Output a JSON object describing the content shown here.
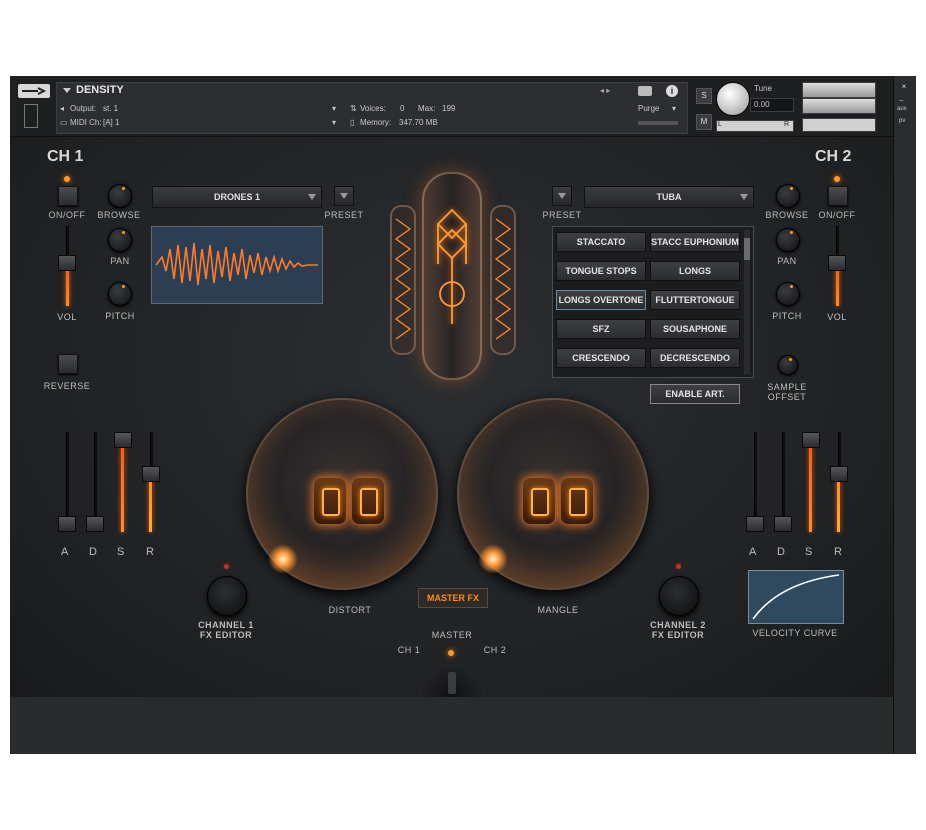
{
  "header": {
    "title": "DENSITY",
    "output_label": "Output:",
    "output_value": "st. 1",
    "midi_label": "MIDI Ch:",
    "midi_value": "[A]  1",
    "voices_label": "Voices:",
    "voices_value": "0",
    "max_label": "Max:",
    "max_value": "199",
    "memory_label": "Memory:",
    "memory_value": "347.70 MB",
    "purge_label": "Purge",
    "tune_label": "Tune",
    "tune_value": "0.00",
    "s_label": "S",
    "m_label": "M",
    "l_label": "L",
    "r_label": "R",
    "aux_label": "aux",
    "pv_label": "pv",
    "close_label": "×",
    "min_label": "−"
  },
  "ch1": {
    "title": "CH 1",
    "on_off": "ON/OFF",
    "browse": "BROWSE",
    "pan": "PAN",
    "pitch": "PITCH",
    "vol": "VOL",
    "reverse": "REVERSE",
    "preset_label": "PRESET",
    "preset_value": "DRONES 1",
    "adsr": [
      "A",
      "D",
      "S",
      "R"
    ],
    "adsr_levels": [
      0.0,
      0.0,
      1.0,
      0.6
    ],
    "vol_level": 0.55
  },
  "ch2": {
    "title": "CH 2",
    "on_off": "ON/OFF",
    "browse": "BROWSE",
    "pan": "PAN",
    "pitch": "PITCH",
    "vol": "VOL",
    "preset_label": "PRESET",
    "preset_value": "TUBA",
    "sample_offset": "SAMPLE\nOFFSET",
    "adsr": [
      "A",
      "D",
      "S",
      "R"
    ],
    "adsr_levels": [
      0.0,
      0.0,
      1.0,
      0.6
    ],
    "vol_level": 0.55,
    "articulations": [
      "STACCATO",
      "STACC EUPHONIUM",
      "TONGUE STOPS",
      "LONGS",
      "LONGS OVERTONE",
      "FLUTTERTONGUE",
      "SFZ",
      "SOUSAPHONE",
      "CRESCENDO",
      "DECRESCENDO"
    ],
    "active_articulation": "LONGS OVERTONE",
    "enable_art": "ENABLE ART.",
    "velocity_curve": "VELOCITY CURVE"
  },
  "center": {
    "distort": "DISTORT",
    "mangle": "MANGLE",
    "master_fx": "MASTER FX",
    "master": "MASTER",
    "ch1": "CH 1",
    "ch2": "CH 2",
    "channel1_fx_line1": "CHANNEL 1",
    "channel1_fx_line2": "FX EDITOR",
    "channel2_fx_line1": "CHANNEL 2",
    "channel2_fx_line2": "FX EDITOR"
  },
  "colors": {
    "accent": "#ff8a1e",
    "panel": "#232527",
    "text": "#bdbdbd"
  }
}
